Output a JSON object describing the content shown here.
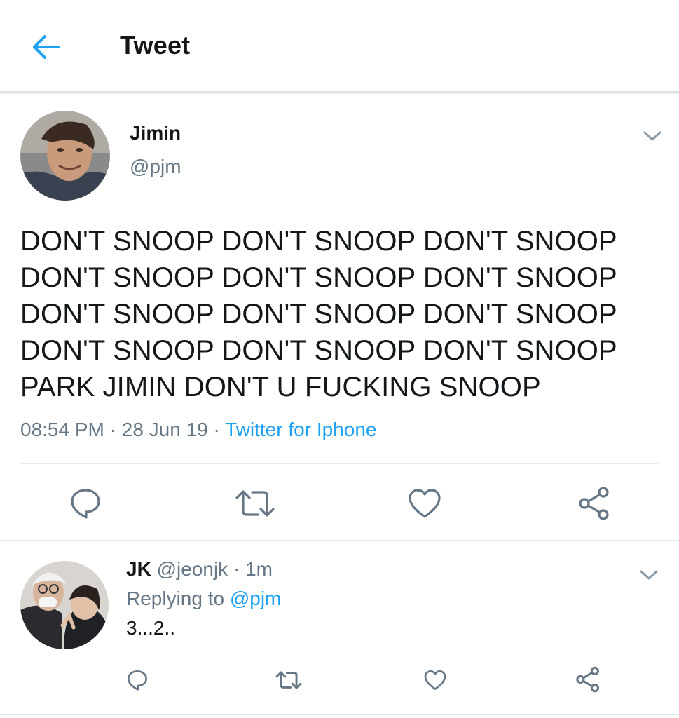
{
  "header": {
    "back_icon": "arrow-left-icon",
    "title": "Tweet"
  },
  "tweet": {
    "author_name": "Jimin",
    "author_handle": "@pjm",
    "text_lines": [
      "DON'T SNOOP DON'T SNOOP DON'T SNOOP",
      "DON'T SNOOP DON'T SNOOP DON'T SNOOP",
      "DON'T SNOOP DON'T SNOOP DON'T SNOOP",
      "DON'T SNOOP DON'T SNOOP DON'T SNOOP",
      "PARK JIMIN DON'T U FUCKING SNOOP"
    ],
    "time": "08:54 PM",
    "sep1": " · ",
    "date": "28 Jun 19",
    "sep2": " · ",
    "source": "Twitter for Iphone",
    "actions": [
      "reply-icon",
      "retweet-icon",
      "like-icon",
      "share-icon"
    ]
  },
  "reply": {
    "author_name": "JK",
    "author_handle": "@jeonjk",
    "sep": " · ",
    "age": "1m",
    "replying_prefix": "Replying to ",
    "replying_to": "@pjm",
    "text": "3...2..",
    "actions": [
      "reply-icon",
      "retweet-icon",
      "like-icon",
      "share-icon"
    ]
  },
  "colors": {
    "accent": "#1da1f2",
    "icon": "#657786",
    "text": "#14171a",
    "divider": "#e6ecf0"
  }
}
